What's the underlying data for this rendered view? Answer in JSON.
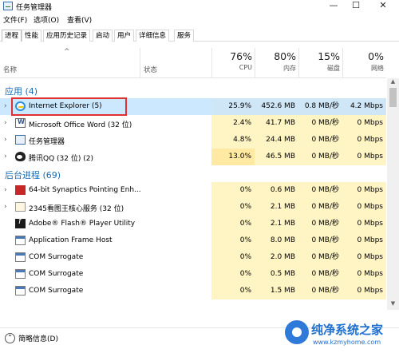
{
  "window": {
    "title": "任务管理器",
    "controls": {
      "minimize": "—",
      "maximize": "☐",
      "close": "✕"
    }
  },
  "menu": [
    "文件(F)",
    "选项(O)",
    "查看(V)"
  ],
  "tabs": [
    "进程",
    "性能",
    "应用历史记录",
    "启动",
    "用户",
    "详细信息",
    "服务"
  ],
  "header": {
    "name": "名称",
    "status": "状态",
    "sort_icon": "^",
    "cpu": {
      "pct": "76%",
      "label": "CPU"
    },
    "mem": {
      "pct": "80%",
      "label": "内存"
    },
    "disk": {
      "pct": "15%",
      "label": "磁盘"
    },
    "net": {
      "pct": "0%",
      "label": "网络"
    }
  },
  "sections": {
    "apps": "应用 (4)",
    "background": "后台进程 (69)"
  },
  "apps": [
    {
      "icon": "ie-icon",
      "name": "Internet Explorer (5)",
      "cpu": "25.9%",
      "mem": "452.6 MB",
      "disk": "0.8 MB/秒",
      "net": "4.2 Mbps",
      "expand": "›"
    },
    {
      "icon": "word-icon",
      "name": "Microsoft Office Word (32 位)",
      "cpu": "2.4%",
      "mem": "41.7 MB",
      "disk": "0 MB/秒",
      "net": "0 Mbps",
      "expand": "›"
    },
    {
      "icon": "task-manager-icon",
      "name": "任务管理器",
      "cpu": "4.8%",
      "mem": "24.4 MB",
      "disk": "0 MB/秒",
      "net": "0 Mbps",
      "expand": "›"
    },
    {
      "icon": "qq-icon",
      "name": "腾讯QQ (32 位) (2)",
      "cpu": "13.0%",
      "mem": "46.5 MB",
      "disk": "0 MB/秒",
      "net": "0 Mbps",
      "expand": "›"
    }
  ],
  "background": [
    {
      "icon": "synaptics-icon",
      "name": "64-bit Synaptics Pointing Enh...",
      "cpu": "0%",
      "mem": "0.6 MB",
      "disk": "0 MB/秒",
      "net": "0 Mbps",
      "expand": "›"
    },
    {
      "icon": "image-viewer-icon",
      "name": "2345看图王核心服务 (32 位)",
      "cpu": "0%",
      "mem": "2.1 MB",
      "disk": "0 MB/秒",
      "net": "0 Mbps",
      "expand": "›"
    },
    {
      "icon": "flash-icon",
      "name": "Adobe® Flash® Player Utility",
      "cpu": "0%",
      "mem": "2.1 MB",
      "disk": "0 MB/秒",
      "net": "0 Mbps",
      "expand": ""
    },
    {
      "icon": "app-frame-icon",
      "name": "Application Frame Host",
      "cpu": "0%",
      "mem": "8.0 MB",
      "disk": "0 MB/秒",
      "net": "0 Mbps",
      "expand": ""
    },
    {
      "icon": "com-icon",
      "name": "COM Surrogate",
      "cpu": "0%",
      "mem": "2.0 MB",
      "disk": "0 MB/秒",
      "net": "0 Mbps",
      "expand": ""
    },
    {
      "icon": "com-icon",
      "name": "COM Surrogate",
      "cpu": "0%",
      "mem": "0.5 MB",
      "disk": "0 MB/秒",
      "net": "0 Mbps",
      "expand": ""
    },
    {
      "icon": "com-icon",
      "name": "COM Surrogate",
      "cpu": "0%",
      "mem": "1.5 MB",
      "disk": "0 MB/秒",
      "net": "0 Mbps",
      "expand": ""
    }
  ],
  "footer": {
    "fewer_details": "简略信息(D)",
    "fewer_icon_glyph": "⌃"
  },
  "watermark": {
    "text": "纯净系统之家",
    "url": "www.kzmyhome.com"
  },
  "colors": {
    "section": "#1a6bb5",
    "highlight": "#cce8ff",
    "cpu_heat": "#ffe9a3",
    "annotation": "#e03030"
  }
}
